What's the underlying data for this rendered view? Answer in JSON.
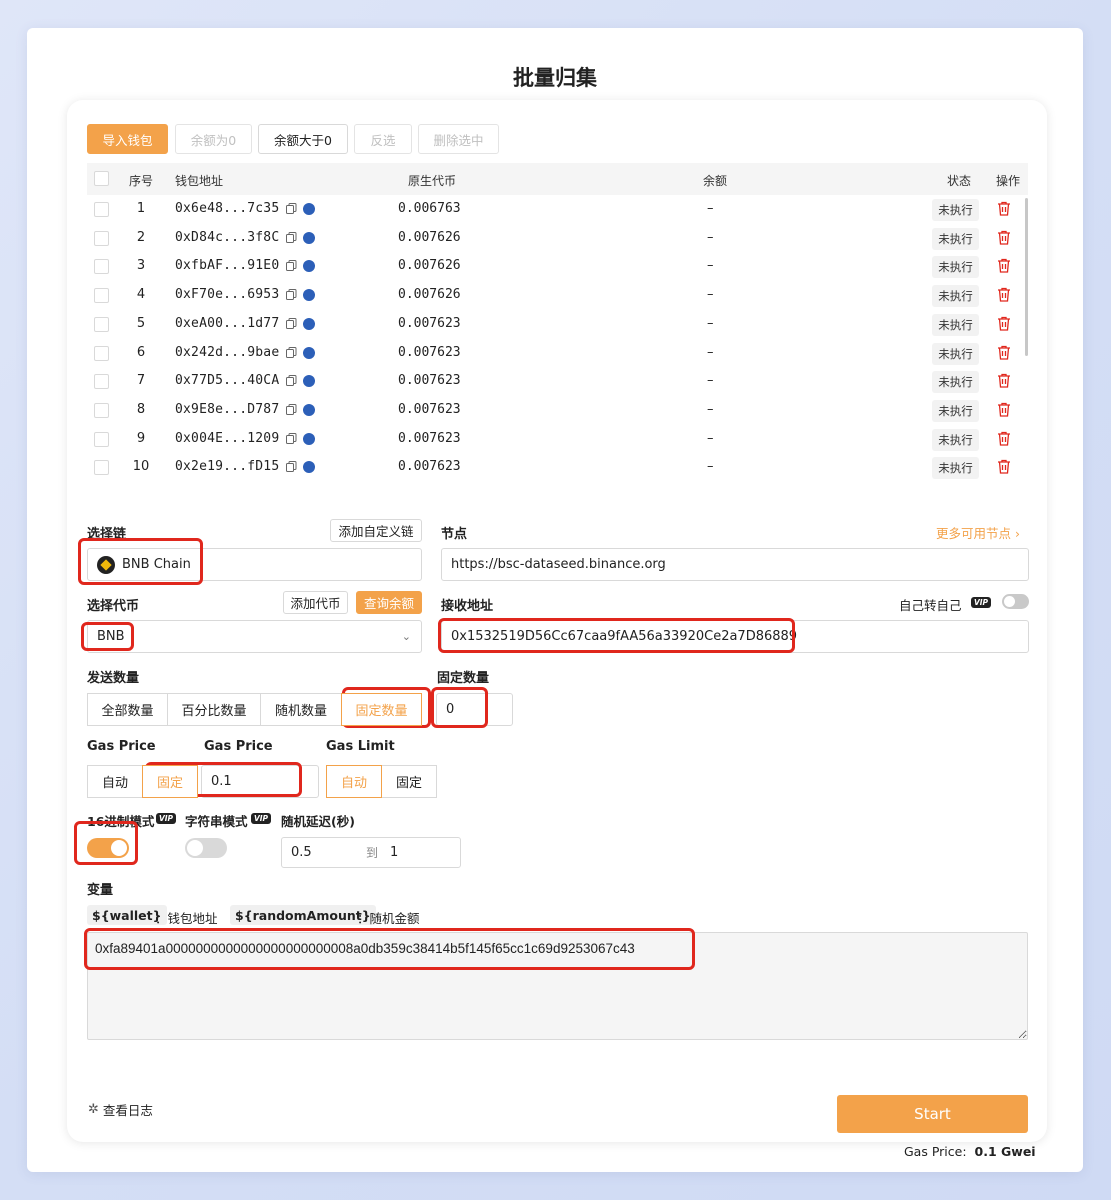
{
  "page": {
    "title": "批量归集"
  },
  "toolbar": {
    "import_wallet": "导入钱包",
    "balance_zero": "余额为0",
    "balance_gt_zero": "余额大于0",
    "invert_select": "反选",
    "delete_selected": "删除选中"
  },
  "table": {
    "headers": {
      "index": "序号",
      "address": "钱包地址",
      "native": "原生代币",
      "balance": "余额",
      "status": "状态",
      "action": "操作"
    },
    "rows": [
      {
        "index": "1",
        "address": "0x6e48...7c35",
        "native": "0.006763",
        "balance": "–",
        "status": "未执行"
      },
      {
        "index": "2",
        "address": "0xD84c...3f8C",
        "native": "0.007626",
        "balance": "–",
        "status": "未执行"
      },
      {
        "index": "3",
        "address": "0xfbAF...91E0",
        "native": "0.007626",
        "balance": "–",
        "status": "未执行"
      },
      {
        "index": "4",
        "address": "0xF70e...6953",
        "native": "0.007626",
        "balance": "–",
        "status": "未执行"
      },
      {
        "index": "5",
        "address": "0xeA00...1d77",
        "native": "0.007623",
        "balance": "–",
        "status": "未执行"
      },
      {
        "index": "6",
        "address": "0x242d...9bae",
        "native": "0.007623",
        "balance": "–",
        "status": "未执行"
      },
      {
        "index": "7",
        "address": "0x77D5...40CA",
        "native": "0.007623",
        "balance": "–",
        "status": "未执行"
      },
      {
        "index": "8",
        "address": "0x9E8e...D787",
        "native": "0.007623",
        "balance": "–",
        "status": "未执行"
      },
      {
        "index": "9",
        "address": "0x004E...1209",
        "native": "0.007623",
        "balance": "–",
        "status": "未执行"
      },
      {
        "index": "10",
        "address": "0x2e19...fD15",
        "native": "0.007623",
        "balance": "–",
        "status": "未执行"
      }
    ]
  },
  "chain": {
    "label": "选择链",
    "add_custom": "添加自定义链",
    "value": "BNB Chain"
  },
  "node": {
    "label": "节点",
    "more": "更多可用节点 ›",
    "value": "https://bsc-dataseed.binance.org"
  },
  "token": {
    "label": "选择代币",
    "add_token": "添加代币",
    "query_balance": "查询余额",
    "value": "BNB"
  },
  "receive": {
    "label": "接收地址",
    "self_transfer": "自己转自己",
    "vip": "VIP",
    "value": "0x1532519D56Cc67caa9fAA56a33920Ce2a7D86889"
  },
  "send_amount": {
    "label": "发送数量",
    "options": [
      "全部数量",
      "百分比数量",
      "随机数量",
      "固定数量"
    ],
    "active_index": 3
  },
  "fixed_amount": {
    "label": "固定数量",
    "value": "0"
  },
  "gas_price_mode": {
    "label": "Gas Price",
    "options": [
      "自动",
      "固定"
    ],
    "active_index": 1
  },
  "gas_price": {
    "label": "Gas Price",
    "value": "0.1"
  },
  "gas_limit": {
    "label": "Gas Limit",
    "options": [
      "自动",
      "固定"
    ],
    "active_index": 0
  },
  "hex_mode": {
    "label": "16进制模式",
    "vip": "VIP",
    "enabled": true
  },
  "string_mode": {
    "label": "字符串模式",
    "vip": "VIP",
    "enabled": false
  },
  "delay": {
    "label": "随机延迟(秒)",
    "from": "0.5",
    "to_label": "到",
    "to": "1"
  },
  "variables": {
    "label": "变量",
    "wallet_tag": "${wallet}",
    "wallet_desc": "：钱包地址",
    "amount_tag": "${randomAmount}",
    "amount_desc": "：随机金额"
  },
  "data_input": {
    "value": "0xfa89401a0000000000000000000000008a0db359c38414b5f145f65cc1c69d9253067c43"
  },
  "footer": {
    "view_log": "查看日志",
    "start": "Start",
    "gas_price_label": "Gas Price:",
    "gas_price_value": "0.1 Gwei"
  },
  "colors": {
    "accent": "#f3a24a",
    "highlight": "#e0271d",
    "delete": "#e0271d"
  }
}
